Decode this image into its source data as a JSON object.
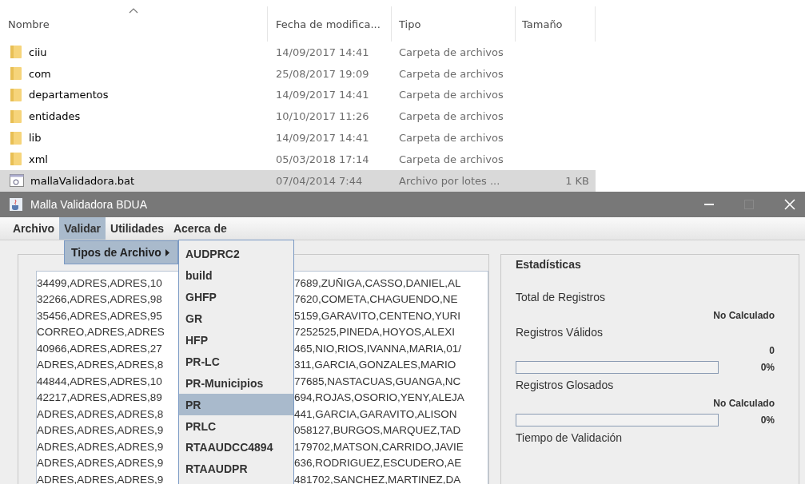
{
  "explorer": {
    "columns": [
      {
        "label": "Nombre",
        "sorted": true
      },
      {
        "label": "Fecha de modifica...",
        "sorted": false
      },
      {
        "label": "Tipo",
        "sorted": false
      },
      {
        "label": "Tamaño",
        "sorted": false
      }
    ],
    "rows": [
      {
        "kind": "folder",
        "name": "ciiu",
        "date": "14/09/2017 14:41",
        "type": "Carpeta de archivos",
        "selected": false
      },
      {
        "kind": "folder",
        "name": "com",
        "date": "25/08/2017 19:09",
        "type": "Carpeta de archivos",
        "selected": false
      },
      {
        "kind": "folder",
        "name": "departamentos",
        "date": "14/09/2017 14:41",
        "type": "Carpeta de archivos",
        "selected": false
      },
      {
        "kind": "folder",
        "name": "entidades",
        "date": "10/10/2017 11:26",
        "type": "Carpeta de archivos",
        "selected": false
      },
      {
        "kind": "folder",
        "name": "lib",
        "date": "14/09/2017 14:41",
        "type": "Carpeta de archivos",
        "selected": false
      },
      {
        "kind": "folder",
        "name": "xml",
        "date": "05/03/2018 17:14",
        "type": "Carpeta de archivos",
        "selected": false
      },
      {
        "kind": "batch",
        "name": "mallaValidadora.bat",
        "date": "07/04/2014 7:44",
        "type": "Archivo por lotes ...",
        "size": "1 KB",
        "selected": true
      }
    ]
  },
  "window": {
    "title": "Malla Validadora BDUA"
  },
  "menu_bar": [
    {
      "label": "Archivo",
      "selected": false
    },
    {
      "label": "Validar",
      "selected": true
    },
    {
      "label": "Utilidades",
      "selected": false
    },
    {
      "label": "Acerca de",
      "selected": false
    }
  ],
  "menu": {
    "items": [
      {
        "label": "Tipos de Archivo",
        "selected": true
      }
    ]
  },
  "submenu": {
    "items": [
      {
        "label": "AUDPRC2",
        "selected": false
      },
      {
        "label": "build",
        "selected": false
      },
      {
        "label": "GHFP",
        "selected": false
      },
      {
        "label": "GR",
        "selected": false
      },
      {
        "label": "HFP",
        "selected": false
      },
      {
        "label": "PR-LC",
        "selected": false
      },
      {
        "label": "PR-Municipios",
        "selected": false
      },
      {
        "label": "PR",
        "selected": true
      },
      {
        "label": "PRLC",
        "selected": false
      },
      {
        "label": "RTAAUDCC4894",
        "selected": false
      },
      {
        "label": "RTAAUDPR",
        "selected": false
      }
    ]
  },
  "text_area": {
    "lines": [
      {
        "left": "34499,ADRES,ADRES,10",
        "right": "7689,ZUÑIGA,CASSO,DANIEL,AL"
      },
      {
        "left": "32266,ADRES,ADRES,98",
        "right": "7620,COMETA,CHAGUENDO,NE"
      },
      {
        "left": "35456,ADRES,ADRES,95",
        "right": "5159,GARAVITO,CENTENO,YURI"
      },
      {
        "left": "CORREO,ADRES,ADRES",
        "right": "7252525,PINEDA,HOYOS,ALEXI"
      },
      {
        "left": "40966,ADRES,ADRES,27",
        "right": "465,NIO,RIOS,IVANNA,MARIA,01/"
      },
      {
        "left": "ADRES,ADRES,ADRES,8",
        "right": "311,GARCIA,GONZALES,MARIO"
      },
      {
        "left": "44844,ADRES,ADRES,10",
        "right": "77685,NASTACUAS,GUANGA,NC"
      },
      {
        "left": "42217,ADRES,ADRES,89",
        "right": "694,ROJAS,OSORIO,YENY,ALEJA"
      },
      {
        "left": "ADRES,ADRES,ADRES,8",
        "right": "441,GARCIA,GARAVITO,ALISON"
      },
      {
        "left": "ADRES,ADRES,ADRES,9",
        "right": "058127,BURGOS,MARQUEZ,TAD"
      },
      {
        "left": "ADRES,ADRES,ADRES,9",
        "right": "179702,MATSON,CARRIDO,JAVIE"
      },
      {
        "left": "ADRES,ADRES,ADRES,9",
        "right": "636,RODRIGUEZ,ESCUDERO,AE"
      },
      {
        "left": "ADRES,ADRES,ADRES,9",
        "right": "481702,SANCHEZ,MARTINEZ,DA"
      }
    ]
  },
  "statistics": {
    "title": "Estadísticas",
    "total_label": "Total de Registros",
    "total_value": "No Calculado",
    "valid_label": "Registros Válidos",
    "valid_value": "0",
    "valid_bar": {
      "level": 0
    },
    "valid_percent": "0%",
    "glosados_label": "Registros Glosados",
    "glosados_value": "No Calculado",
    "glosados_bar": {
      "level": 0
    },
    "glosados_percent": "0%",
    "time_label": "Tiempo de Validación"
  }
}
